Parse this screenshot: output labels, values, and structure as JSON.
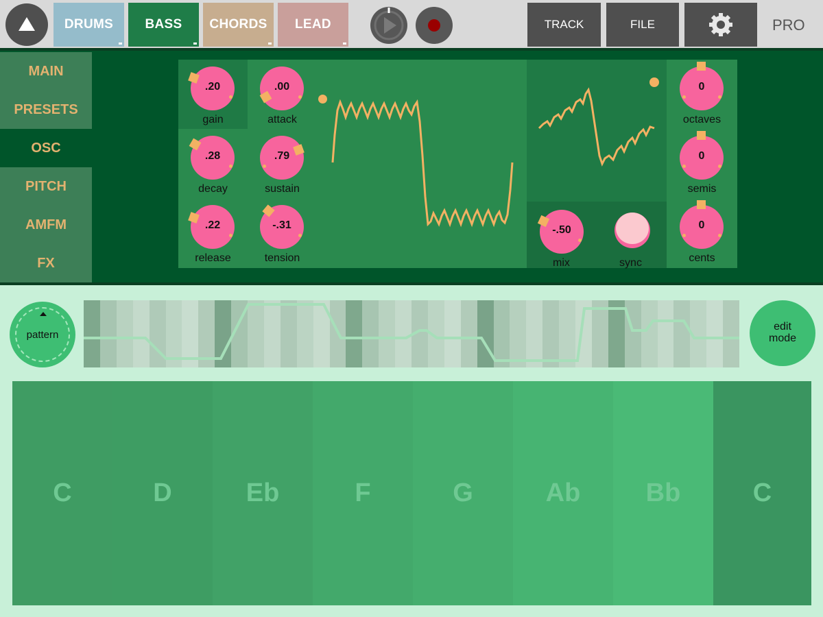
{
  "topbar": {
    "tabs": [
      {
        "label": "DRUMS",
        "color": "#95bccb"
      },
      {
        "label": "BASS",
        "color": "#1f7d48"
      },
      {
        "label": "CHORDS",
        "color": "#c7ad8f"
      },
      {
        "label": "LEAD",
        "color": "#c99f9b"
      }
    ],
    "active_tab": "BASS",
    "track_label": "TRACK",
    "file_label": "FILE",
    "pro_label": "PRO"
  },
  "sidebar": {
    "items": [
      {
        "label": "MAIN"
      },
      {
        "label": "PRESETS"
      },
      {
        "label": "OSC"
      },
      {
        "label": "PITCH"
      },
      {
        "label": "AMFM"
      },
      {
        "label": "FX"
      }
    ],
    "active": "OSC"
  },
  "envelope": {
    "gain": {
      "label": "gain",
      "value": ".20"
    },
    "attack": {
      "label": "attack",
      "value": ".00"
    },
    "decay": {
      "label": "decay",
      "value": ".28"
    },
    "sustain": {
      "label": "sustain",
      "value": ".79"
    },
    "release": {
      "label": "release",
      "value": ".22"
    },
    "tension": {
      "label": "tension",
      "value": "-.31"
    }
  },
  "mixer": {
    "mix": {
      "label": "mix",
      "value": "-.50"
    },
    "sync": {
      "label": "sync"
    }
  },
  "pitch": {
    "octaves": {
      "label": "octaves",
      "value": "0"
    },
    "semis": {
      "label": "semis",
      "value": "0"
    },
    "cents": {
      "label": "cents",
      "value": "0"
    }
  },
  "sequencer": {
    "pattern_label": "pattern",
    "edit_label_1": "edit",
    "edit_label_2": "mode"
  },
  "keyboard": {
    "keys": [
      "C",
      "D",
      "Eb",
      "F",
      "G",
      "Ab",
      "Bb",
      "C"
    ]
  },
  "colors": {
    "knob": "#f7649d",
    "accent": "#f3b163",
    "panel": "#00552a",
    "keyboard_label": "#6fc993"
  }
}
